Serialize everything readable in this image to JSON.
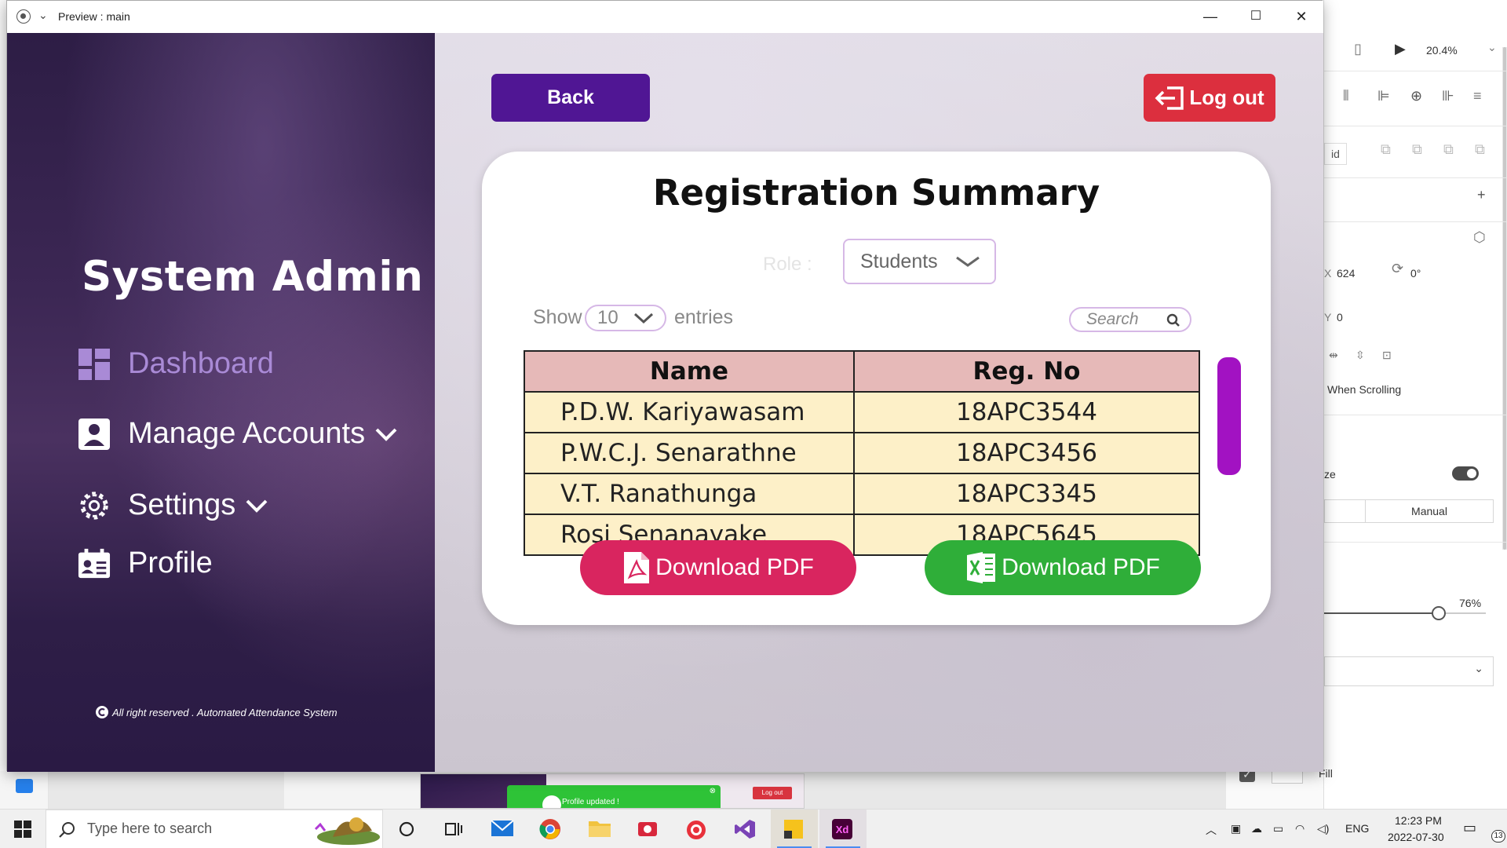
{
  "xd": {
    "zoom": "20.4%",
    "x_label": "X",
    "x_value": "624",
    "y_label": "Y",
    "y_value": "0",
    "rotation": "0°",
    "when_scrolling": "When Scrolling",
    "size_label": "ze",
    "manual_label": "Manual",
    "opacity": "76%",
    "fill_label": "Fill",
    "grid_label": "id"
  },
  "thumbnail": {
    "toast_text": "Profile updated !",
    "logout_label": "Log out"
  },
  "window": {
    "title": "Preview : main"
  },
  "sidebar": {
    "title": "System Admin",
    "items": [
      {
        "label": "Dashboard"
      },
      {
        "label": "Manage Accounts"
      },
      {
        "label": "Settings"
      },
      {
        "label": "Profile"
      }
    ],
    "copyright": "All right reserved . Automated Attendance System"
  },
  "main": {
    "back_label": "Back",
    "logout_label": "Log out",
    "card_title": "Registration Summary",
    "role_label": "Role :",
    "role_value": "Students",
    "show_label": "Show",
    "entries_value": "10",
    "entries_label": "entries",
    "search_placeholder": "Search",
    "table": {
      "headers": [
        "Name",
        "Reg. No"
      ],
      "rows": [
        [
          "P.D.W. Kariyawasam",
          "18APC3544"
        ],
        [
          "P.W.C.J. Senarathne",
          "18APC3456"
        ],
        [
          "V.T. Ranathunga",
          "18APC3345"
        ],
        [
          "Rosi Senanayake",
          "18APC5645"
        ]
      ]
    },
    "download_pdf_label": "Download PDF",
    "download_excel_label": "Download PDF"
  },
  "taskbar": {
    "search_placeholder": "Type here to search",
    "language": "ENG",
    "time": "12:23 PM",
    "date": "2022-07-30",
    "notifications": "13",
    "apps": [
      "cortana-icon",
      "task-view-icon",
      "mail-icon",
      "chrome-icon",
      "file-explorer-icon",
      "screen-recorder-icon",
      "app-icon",
      "visual-studio-icon",
      "sticky-notes-icon",
      "adobe-xd-icon"
    ]
  },
  "colors": {
    "back_button": "#501694",
    "logout_button": "#dc2f3e",
    "pdf_button": "#d9255f",
    "excel_button": "#2fae39",
    "table_header": "#e6b9b8",
    "table_row": "#fdf0c8",
    "dashboard_active": "#a98ad6",
    "scrollbar": "#a212c2"
  }
}
